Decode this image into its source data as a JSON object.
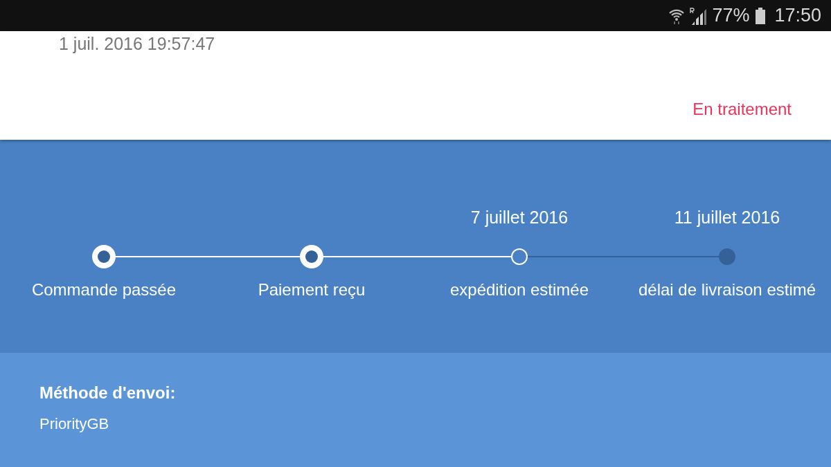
{
  "status_bar": {
    "battery": "77%",
    "time": "17:50"
  },
  "order": {
    "date": "1 juil. 2016 19:57:47",
    "status": "En traitement"
  },
  "steps": [
    {
      "label": "Commande passée",
      "kind": "done"
    },
    {
      "label": "Paiement reçu",
      "kind": "done"
    },
    {
      "label": "expédition estimée",
      "date": "7 juillet 2016",
      "kind": "current"
    },
    {
      "label": "délai de livraison estimé",
      "date": "11 juillet 2016",
      "kind": "pending"
    }
  ],
  "shipping": {
    "title": "Méthode d'envoi:",
    "value": "PriorityGB"
  }
}
